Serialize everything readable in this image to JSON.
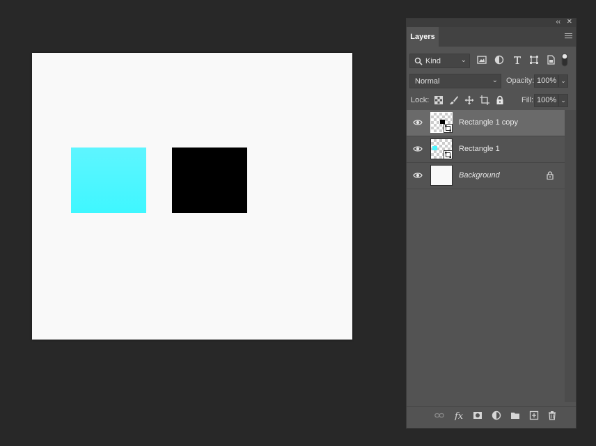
{
  "panel": {
    "tab_label": "Layers",
    "collapse_glyph": "‹‹",
    "close_glyph": "✕"
  },
  "filter": {
    "kind_label": "Kind",
    "icons": [
      "image-filter-icon",
      "adjustment-filter-icon",
      "type-filter-icon",
      "shape-filter-icon",
      "smart-object-filter-icon",
      "filter-toggle-icon"
    ]
  },
  "blend": {
    "mode": "Normal",
    "opacity_label": "Opacity:",
    "opacity_value": "100%"
  },
  "lock": {
    "label": "Lock:",
    "fill_label": "Fill:",
    "fill_value": "100%"
  },
  "layers": [
    {
      "name": "Rectangle 1 copy",
      "selected": true,
      "visible": true,
      "swatch": "#000000"
    },
    {
      "name": "Rectangle 1",
      "selected": false,
      "visible": true,
      "swatch": "#4df6ff"
    },
    {
      "name": "Background",
      "selected": false,
      "visible": true,
      "locked": true
    }
  ],
  "colors": {
    "workspace": "#282828",
    "canvas": "#f9f9f9",
    "cyan_top": "#5ef5ff",
    "cyan_bottom": "#3ff7ff",
    "black": "#000000",
    "panel": "#535353",
    "selected_layer": "#6a6a6a"
  }
}
